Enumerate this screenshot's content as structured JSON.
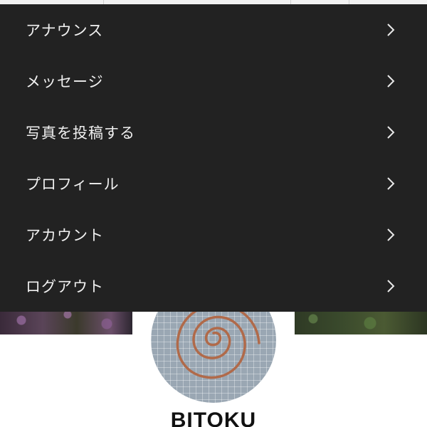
{
  "menu": {
    "items": [
      {
        "label": "アナウンス",
        "icon": "chevron-right-icon"
      },
      {
        "label": "メッセージ",
        "icon": "chevron-right-icon"
      },
      {
        "label": "写真を投稿する",
        "icon": "chevron-right-icon"
      },
      {
        "label": "プロフィール",
        "icon": "chevron-right-icon"
      },
      {
        "label": "アカウント",
        "icon": "chevron-right-icon"
      },
      {
        "label": "ログアウト",
        "icon": "chevron-right-icon"
      }
    ],
    "background": "#222222",
    "text_color": "#f0f0f0"
  },
  "profile": {
    "name": "BITOKU"
  }
}
